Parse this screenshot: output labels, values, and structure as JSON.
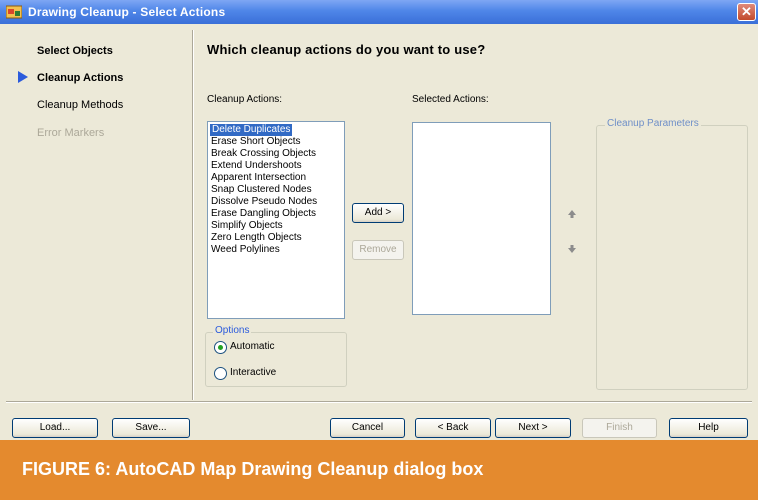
{
  "window": {
    "title": "Drawing Cleanup - Select Actions",
    "close_glyph": "✕"
  },
  "sidebar": {
    "items": [
      {
        "label": "Select Objects",
        "state": "done"
      },
      {
        "label": "Cleanup Actions",
        "state": "current"
      },
      {
        "label": "Cleanup Methods",
        "state": "pending"
      },
      {
        "label": "Error Markers",
        "state": "disabled"
      }
    ]
  },
  "main": {
    "heading": "Which cleanup actions do you want to use?",
    "cleanup_actions_label": "Cleanup Actions:",
    "selected_actions_label": "Selected Actions:",
    "cleanup_parameters_label": "Cleanup Parameters",
    "cleanup_actions": [
      "Delete Duplicates",
      "Erase Short Objects",
      "Break Crossing Objects",
      "Extend Undershoots",
      "Apparent Intersection",
      "Snap Clustered Nodes",
      "Dissolve Pseudo Nodes",
      "Erase Dangling Objects",
      "Simplify Objects",
      "Zero Length Objects",
      "Weed Polylines"
    ],
    "selected_index": 0,
    "add_button": "Add >",
    "remove_button": "Remove",
    "move_up_icon": "arrow-up-icon",
    "move_down_icon": "arrow-down-icon",
    "options": {
      "title": "Options",
      "automatic": "Automatic",
      "interactive": "Interactive",
      "selected": "automatic"
    }
  },
  "footer": {
    "load": "Load...",
    "save": "Save...",
    "cancel": "Cancel",
    "back": "< Back",
    "next": "Next >",
    "finish": "Finish",
    "help": "Help"
  },
  "caption": "FIGURE 6: AutoCAD Map Drawing Cleanup dialog box",
  "colors": {
    "titlebar": "#3a6fd8",
    "dialog_bg": "#ece9d8",
    "selection": "#316ac5",
    "caption_bg": "#e48a2e"
  }
}
